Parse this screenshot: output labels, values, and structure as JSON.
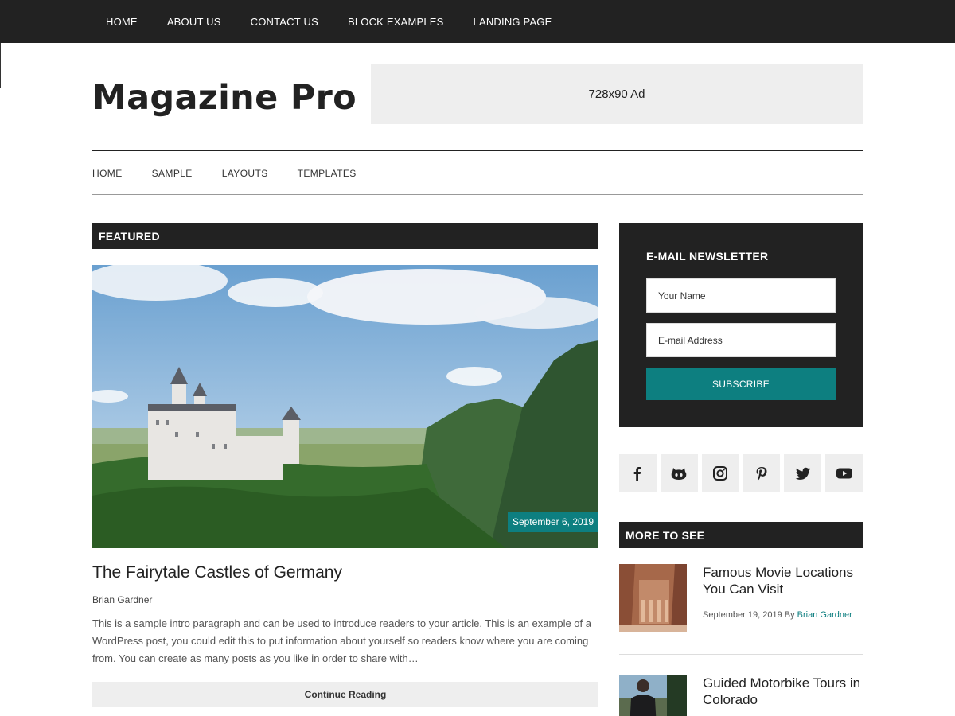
{
  "topbar": {
    "items": [
      "HOME",
      "ABOUT US",
      "CONTACT US",
      "BLOCK EXAMPLES",
      "LANDING PAGE"
    ]
  },
  "header": {
    "site_title": "Magazine Pro",
    "ad_label": "728x90 Ad"
  },
  "secondary_nav": {
    "items": [
      "HOME",
      "SAMPLE",
      "LAYOUTS",
      "TEMPLATES"
    ]
  },
  "featured": {
    "section_title": "FEATURED",
    "date": "September 6, 2019",
    "post_title": "The Fairytale Castles of Germany",
    "author": "Brian Gardner",
    "excerpt": "This is a sample intro paragraph and can be used to introduce readers to your article. This is an example of a WordPress post, you could edit this to put information about yourself so readers know where you are coming from. You can create as many posts as you like in order to share with…",
    "continue_label": "Continue Reading"
  },
  "newsletter": {
    "title": "E-MAIL NEWSLETTER",
    "name_placeholder": "Your Name",
    "email_placeholder": "E-mail Address",
    "subscribe_label": "SUBSCRIBE"
  },
  "social": {
    "icons": [
      "facebook-icon",
      "github-icon",
      "instagram-icon",
      "pinterest-icon",
      "twitter-icon",
      "youtube-icon"
    ]
  },
  "more_to_see": {
    "section_title": "MORE TO SEE",
    "items": [
      {
        "title": "Famous Movie Locations You Can Visit",
        "date": "September 19, 2019",
        "by": "By",
        "author": "Brian Gardner"
      },
      {
        "title": "Guided Motorbike Tours in Colorado"
      }
    ]
  },
  "colors": {
    "dark": "#222222",
    "accent": "#0d7f80",
    "light_gray": "#eeeeee"
  }
}
